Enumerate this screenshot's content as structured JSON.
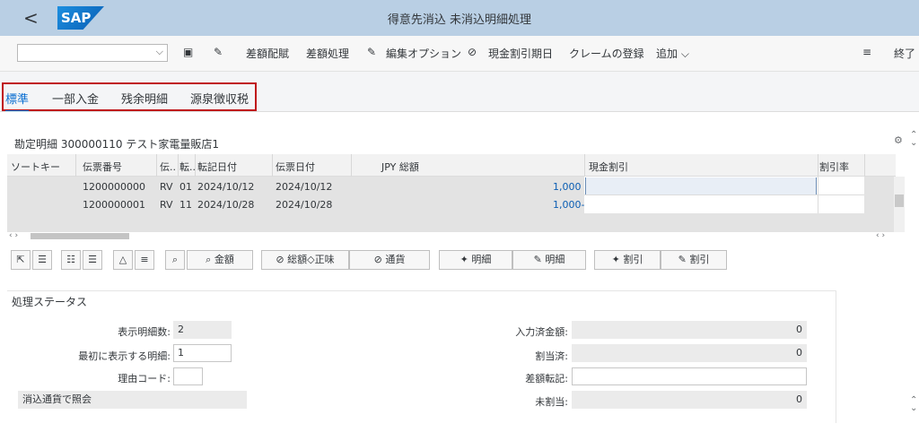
{
  "shell": {
    "title": "得意先消込 未消込明細処理",
    "back": "<",
    "logo": "SAP"
  },
  "toolbar": {
    "select_value": "",
    "items": [
      "差額配賦",
      "差額処理",
      "編集オプション",
      "現金割引期日",
      "クレームの登録",
      "追加"
    ],
    "exit": "終了"
  },
  "tabs": [
    "標準",
    "一部入金",
    "残余明細",
    "源泉徴収税"
  ],
  "section_title": "勘定明細 300000110 テスト家電量販店1",
  "grid": {
    "columns": [
      "ソートキー",
      "伝票番号",
      "伝..",
      "転..",
      "転記日付",
      "伝票日付",
      "JPY 総額",
      "現金割引",
      "割引率"
    ],
    "rows": [
      {
        "sort_key": "",
        "doc_no": "1200000000",
        "doc_type": "RV",
        "posting_key": "01",
        "posting_date": "2024/10/12",
        "doc_date": "2024/10/12",
        "amount": "1,000",
        "cash_discount": "",
        "discount_rate": ""
      },
      {
        "sort_key": "",
        "doc_no": "1200000001",
        "doc_type": "RV",
        "posting_key": "11",
        "posting_date": "2024/10/28",
        "doc_date": "2024/10/28",
        "amount": "1,000-",
        "cash_discount": "",
        "discount_rate": ""
      }
    ]
  },
  "buttons": [
    "金額",
    "総額◇正味",
    "通貨",
    "明細",
    "明細",
    "割引",
    "割引"
  ],
  "status": {
    "title": "処理ステータス",
    "display_count_label": "表示明細数:",
    "display_count": "2",
    "first_item_label": "最初に表示する明細:",
    "first_item": "1",
    "reason_label": "理由コード:",
    "reason": "",
    "currency_query": "消込通貨で照会",
    "entered_label": "入力済金額:",
    "entered": "0",
    "assigned_label": "割当済:",
    "assigned": "0",
    "diff_label": "差額転記:",
    "diff": "",
    "unassigned_label": "未割当:",
    "unassigned": "0"
  }
}
